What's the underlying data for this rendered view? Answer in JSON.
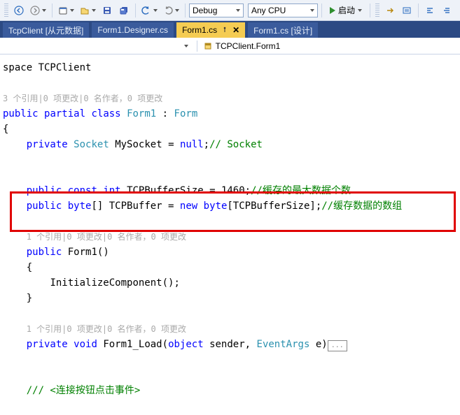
{
  "toolbar": {
    "combo_config": "Debug",
    "combo_platform": "Any CPU",
    "start_label": "启动"
  },
  "tabs": [
    {
      "label": "TcpClient [从元数据]",
      "active": false
    },
    {
      "label": "Form1.Designer.cs",
      "active": false
    },
    {
      "label": "Form1.cs",
      "active": true
    },
    {
      "label": "Form1.cs [设计]",
      "active": false
    }
  ],
  "breadcrumb": {
    "item": "TCPClient.Form1"
  },
  "codelens": {
    "l1": "3 个引用|0 项更改|0 名作者，0 项更改",
    "l2": "1 个引用|0 项更改|0 名作者，0 项更改",
    "l3": "1 个引用|0 项更改|0 名作者，0 项更改"
  },
  "code": {
    "ns_line_prefix": "space ",
    "namespace": "TCPClient",
    "class_decl": {
      "p1": "public",
      "p2": "partial",
      "p3": "class",
      "name": "Form1",
      "colon": ":",
      "base": "Form"
    },
    "socket_line": {
      "mod": "private",
      "type": "Socket",
      "name": "MySocket",
      "eq": "=",
      "nul": "null",
      "semi": ";",
      "cmt": "// Socket"
    },
    "buf1": {
      "mod": "public",
      "cst": "const",
      "typ": "int",
      "name": "TCPBufferSize",
      "eq": "=",
      "val": "1460",
      "semi": ";",
      "cmt": "//缓存的最大数据个数"
    },
    "buf2": {
      "mod": "public",
      "typ": "byte",
      "arr": "[]",
      "name": "TCPBuffer",
      "eq": "=",
      "nw": "new",
      "typ2": "byte",
      "idx": "[TCPBufferSize]",
      "semi": ";",
      "cmt": "//缓存数据的数组"
    },
    "ctor": {
      "mod": "public",
      "name": "Form1",
      "call": "InitializeComponent();"
    },
    "load": {
      "mod": "private",
      "ret": "void",
      "name": "Form1_Load",
      "p_obj": "object",
      "p_s": "sender",
      "p_ea": "EventArgs",
      "p_e": "e",
      "ell": "..."
    },
    "doc_cmt": "/// <连接按钮点击事件>"
  },
  "icons": {
    "back": "nav-back-icon",
    "fwd": "nav-forward-icon"
  }
}
